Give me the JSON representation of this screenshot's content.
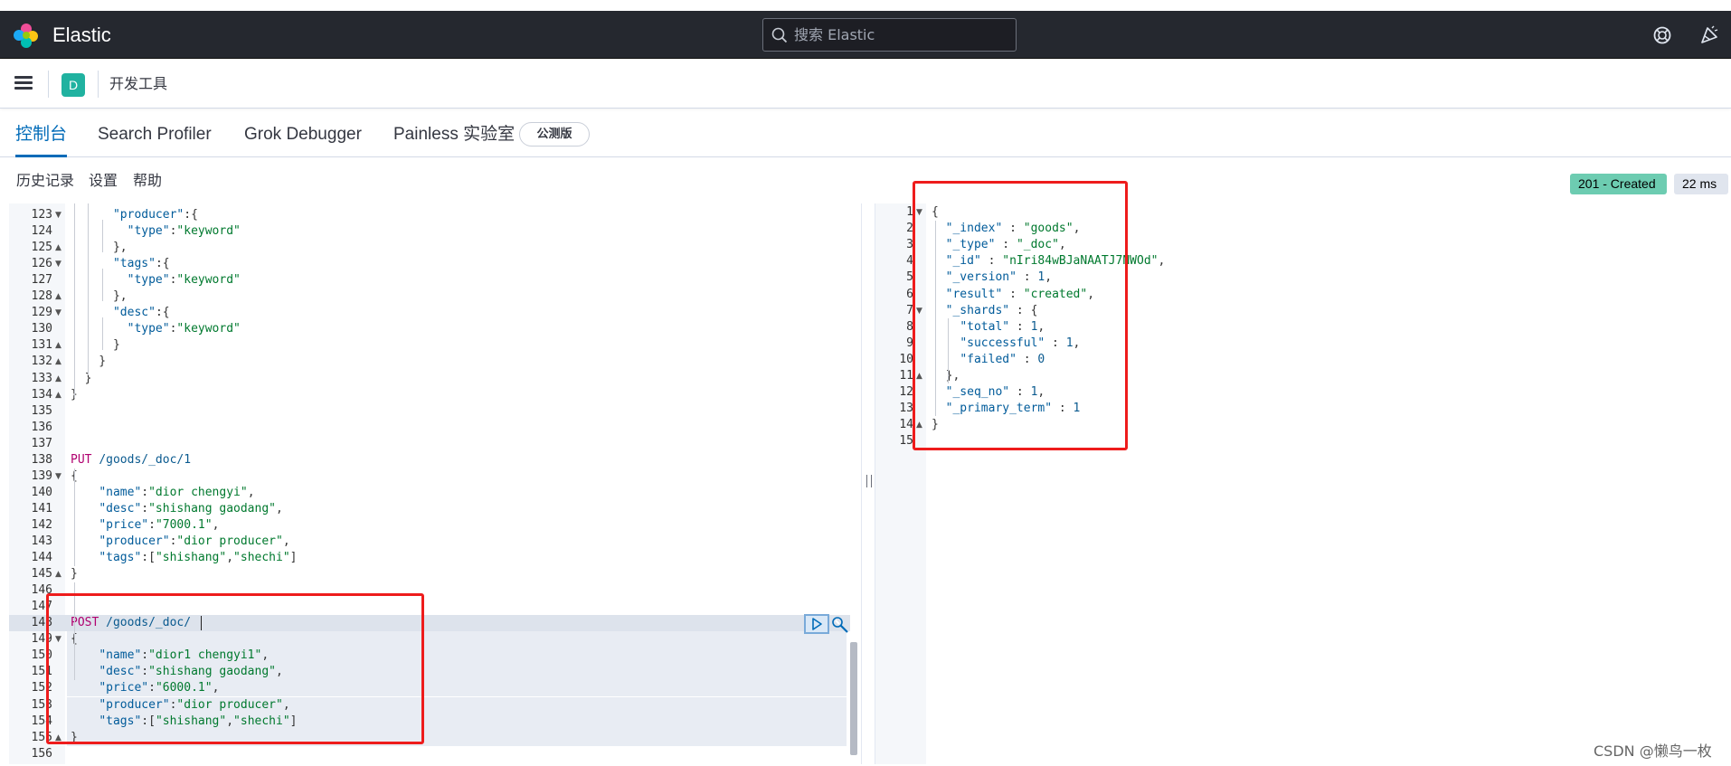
{
  "header": {
    "brand": "Elastic",
    "search_placeholder": "搜索 Elastic",
    "icons": [
      "help-icon",
      "newsfeed-icon"
    ]
  },
  "breadcrumb": {
    "space_initial": "D",
    "title": "开发工具"
  },
  "tabs": [
    {
      "label": "控制台",
      "active": true
    },
    {
      "label": "Search Profiler",
      "active": false
    },
    {
      "label": "Grok Debugger",
      "active": false
    },
    {
      "label": "Painless 实验室",
      "active": false
    }
  ],
  "beta_badge": "公测版",
  "toolbar": {
    "history": "历史记录",
    "settings": "设置",
    "help": "帮助"
  },
  "status": {
    "code": "201 - Created",
    "time": "22 ms"
  },
  "request_lines": [
    {
      "no": "123",
      "fold": "open",
      "indent": 0,
      "tokens": [
        [
          "p",
          "      "
        ],
        [
          "k",
          "\"producer\""
        ],
        [
          "p",
          ":{"
        ]
      ]
    },
    {
      "no": "124",
      "fold": "",
      "tokens": [
        [
          "p",
          "        "
        ],
        [
          "k",
          "\"type\""
        ],
        [
          "p",
          ":"
        ],
        [
          "s",
          "\"keyword\""
        ]
      ]
    },
    {
      "no": "125",
      "fold": "close",
      "tokens": [
        [
          "p",
          "      },"
        ]
      ]
    },
    {
      "no": "126",
      "fold": "open",
      "tokens": [
        [
          "p",
          "      "
        ],
        [
          "k",
          "\"tags\""
        ],
        [
          "p",
          ":{"
        ]
      ]
    },
    {
      "no": "127",
      "fold": "",
      "tokens": [
        [
          "p",
          "        "
        ],
        [
          "k",
          "\"type\""
        ],
        [
          "p",
          ":"
        ],
        [
          "s",
          "\"keyword\""
        ]
      ]
    },
    {
      "no": "128",
      "fold": "close",
      "tokens": [
        [
          "p",
          "      },"
        ]
      ]
    },
    {
      "no": "129",
      "fold": "open",
      "tokens": [
        [
          "p",
          "      "
        ],
        [
          "k",
          "\"desc\""
        ],
        [
          "p",
          ":{"
        ]
      ]
    },
    {
      "no": "130",
      "fold": "",
      "tokens": [
        [
          "p",
          "        "
        ],
        [
          "k",
          "\"type\""
        ],
        [
          "p",
          ":"
        ],
        [
          "s",
          "\"keyword\""
        ]
      ]
    },
    {
      "no": "131",
      "fold": "close",
      "tokens": [
        [
          "p",
          "      }"
        ]
      ]
    },
    {
      "no": "132",
      "fold": "close",
      "tokens": [
        [
          "p",
          "    }"
        ]
      ]
    },
    {
      "no": "133",
      "fold": "close",
      "tokens": [
        [
          "p",
          "  }"
        ]
      ]
    },
    {
      "no": "134",
      "fold": "close",
      "tokens": [
        [
          "p",
          "}"
        ]
      ]
    },
    {
      "no": "135",
      "fold": "",
      "tokens": []
    },
    {
      "no": "136",
      "fold": "",
      "tokens": []
    },
    {
      "no": "137",
      "fold": "",
      "tokens": []
    },
    {
      "no": "138",
      "fold": "",
      "tokens": [
        [
          "m",
          "PUT"
        ],
        [
          "p",
          " "
        ],
        [
          "u",
          "/goods/_doc/1"
        ]
      ]
    },
    {
      "no": "139",
      "fold": "open",
      "tokens": [
        [
          "p",
          "{"
        ]
      ]
    },
    {
      "no": "140",
      "fold": "",
      "tokens": [
        [
          "p",
          "    "
        ],
        [
          "k",
          "\"name\""
        ],
        [
          "p",
          ":"
        ],
        [
          "s",
          "\"dior chengyi\""
        ],
        [
          "p",
          ","
        ]
      ]
    },
    {
      "no": "141",
      "fold": "",
      "tokens": [
        [
          "p",
          "    "
        ],
        [
          "k",
          "\"desc\""
        ],
        [
          "p",
          ":"
        ],
        [
          "s",
          "\"shishang gaodang\""
        ],
        [
          "p",
          ","
        ]
      ]
    },
    {
      "no": "142",
      "fold": "",
      "tokens": [
        [
          "p",
          "    "
        ],
        [
          "k",
          "\"price\""
        ],
        [
          "p",
          ":"
        ],
        [
          "s",
          "\"7000.1\""
        ],
        [
          "p",
          ","
        ]
      ]
    },
    {
      "no": "143",
      "fold": "",
      "tokens": [
        [
          "p",
          "    "
        ],
        [
          "k",
          "\"producer\""
        ],
        [
          "p",
          ":"
        ],
        [
          "s",
          "\"dior producer\""
        ],
        [
          "p",
          ","
        ]
      ]
    },
    {
      "no": "144",
      "fold": "",
      "tokens": [
        [
          "p",
          "    "
        ],
        [
          "k",
          "\"tags\""
        ],
        [
          "p",
          ":["
        ],
        [
          "s",
          "\"shishang\""
        ],
        [
          "p",
          ","
        ],
        [
          "s",
          "\"shechi\""
        ],
        [
          "p",
          "]"
        ]
      ]
    },
    {
      "no": "145",
      "fold": "close",
      "tokens": [
        [
          "p",
          "}"
        ]
      ]
    },
    {
      "no": "146",
      "fold": "",
      "tokens": []
    },
    {
      "no": "147",
      "fold": "",
      "tokens": []
    },
    {
      "no": "148",
      "fold": "",
      "current": true,
      "tokens": [
        [
          "m",
          "POST"
        ],
        [
          "p",
          " "
        ],
        [
          "u",
          "/goods/_doc/"
        ]
      ]
    },
    {
      "no": "149",
      "fold": "open",
      "sel": true,
      "tokens": [
        [
          "p",
          "{"
        ]
      ]
    },
    {
      "no": "150",
      "fold": "",
      "sel": true,
      "tokens": [
        [
          "p",
          "    "
        ],
        [
          "k",
          "\"name\""
        ],
        [
          "p",
          ":"
        ],
        [
          "s",
          "\"dior1 chengyi1\""
        ],
        [
          "p",
          ","
        ]
      ]
    },
    {
      "no": "151",
      "fold": "",
      "sel": true,
      "tokens": [
        [
          "p",
          "    "
        ],
        [
          "k",
          "\"desc\""
        ],
        [
          "p",
          ":"
        ],
        [
          "s",
          "\"shishang gaodang\""
        ],
        [
          "p",
          ","
        ]
      ]
    },
    {
      "no": "152",
      "fold": "",
      "sel": true,
      "tokens": [
        [
          "p",
          "    "
        ],
        [
          "k",
          "\"price\""
        ],
        [
          "p",
          ":"
        ],
        [
          "s",
          "\"6000.1\""
        ],
        [
          "p",
          ","
        ]
      ]
    },
    {
      "no": "153",
      "fold": "",
      "sel": true,
      "tokens": [
        [
          "p",
          "    "
        ],
        [
          "k",
          "\"producer\""
        ],
        [
          "p",
          ":"
        ],
        [
          "s",
          "\"dior producer\""
        ],
        [
          "p",
          ","
        ]
      ]
    },
    {
      "no": "154",
      "fold": "",
      "sel": true,
      "tokens": [
        [
          "p",
          "    "
        ],
        [
          "k",
          "\"tags\""
        ],
        [
          "p",
          ":["
        ],
        [
          "s",
          "\"shishang\""
        ],
        [
          "p",
          ","
        ],
        [
          "s",
          "\"shechi\""
        ],
        [
          "p",
          "]"
        ]
      ]
    },
    {
      "no": "155",
      "fold": "close",
      "sel": true,
      "tokens": [
        [
          "p",
          "}"
        ]
      ]
    },
    {
      "no": "156",
      "fold": "",
      "tokens": []
    }
  ],
  "response_lines": [
    {
      "no": "1",
      "fold": "open",
      "tokens": [
        [
          "p",
          "{"
        ]
      ]
    },
    {
      "no": "2",
      "fold": "",
      "tokens": [
        [
          "p",
          "  "
        ],
        [
          "k",
          "\"_index\""
        ],
        [
          "p",
          " : "
        ],
        [
          "s",
          "\"goods\""
        ],
        [
          "p",
          ","
        ]
      ]
    },
    {
      "no": "3",
      "fold": "",
      "tokens": [
        [
          "p",
          "  "
        ],
        [
          "k",
          "\"_type\""
        ],
        [
          "p",
          " : "
        ],
        [
          "s",
          "\"_doc\""
        ],
        [
          "p",
          ","
        ]
      ]
    },
    {
      "no": "4",
      "fold": "",
      "tokens": [
        [
          "p",
          "  "
        ],
        [
          "k",
          "\"_id\""
        ],
        [
          "p",
          " : "
        ],
        [
          "s",
          "\"nIri84wBJaNAATJ7NWOd\""
        ],
        [
          "p",
          ","
        ]
      ]
    },
    {
      "no": "5",
      "fold": "",
      "tokens": [
        [
          "p",
          "  "
        ],
        [
          "k",
          "\"_version\""
        ],
        [
          "p",
          " : "
        ],
        [
          "n",
          "1"
        ],
        [
          "p",
          ","
        ]
      ]
    },
    {
      "no": "6",
      "fold": "",
      "tokens": [
        [
          "p",
          "  "
        ],
        [
          "k",
          "\"result\""
        ],
        [
          "p",
          " : "
        ],
        [
          "s",
          "\"created\""
        ],
        [
          "p",
          ","
        ]
      ]
    },
    {
      "no": "7",
      "fold": "open",
      "tokens": [
        [
          "p",
          "  "
        ],
        [
          "k",
          "\"_shards\""
        ],
        [
          "p",
          " : {"
        ]
      ]
    },
    {
      "no": "8",
      "fold": "",
      "tokens": [
        [
          "p",
          "    "
        ],
        [
          "k",
          "\"total\""
        ],
        [
          "p",
          " : "
        ],
        [
          "n",
          "1"
        ],
        [
          "p",
          ","
        ]
      ]
    },
    {
      "no": "9",
      "fold": "",
      "tokens": [
        [
          "p",
          "    "
        ],
        [
          "k",
          "\"successful\""
        ],
        [
          "p",
          " : "
        ],
        [
          "n",
          "1"
        ],
        [
          "p",
          ","
        ]
      ]
    },
    {
      "no": "10",
      "fold": "",
      "tokens": [
        [
          "p",
          "    "
        ],
        [
          "k",
          "\"failed\""
        ],
        [
          "p",
          " : "
        ],
        [
          "n",
          "0"
        ]
      ]
    },
    {
      "no": "11",
      "fold": "close",
      "tokens": [
        [
          "p",
          "  },"
        ]
      ]
    },
    {
      "no": "12",
      "fold": "",
      "tokens": [
        [
          "p",
          "  "
        ],
        [
          "k",
          "\"_seq_no\""
        ],
        [
          "p",
          " : "
        ],
        [
          "n",
          "1"
        ],
        [
          "p",
          ","
        ]
      ]
    },
    {
      "no": "13",
      "fold": "",
      "tokens": [
        [
          "p",
          "  "
        ],
        [
          "k",
          "\"_primary_term\""
        ],
        [
          "p",
          " : "
        ],
        [
          "n",
          "1"
        ]
      ]
    },
    {
      "no": "14",
      "fold": "close",
      "tokens": [
        [
          "p",
          "}"
        ]
      ]
    },
    {
      "no": "15",
      "fold": "",
      "tokens": []
    }
  ],
  "watermark": "CSDN @懒鸟一枚",
  "colors": {
    "header_bg": "#25282f",
    "accent": "#006bb8",
    "status_ok": "#6dccb1",
    "annotation_red": "#ee1c1c"
  }
}
